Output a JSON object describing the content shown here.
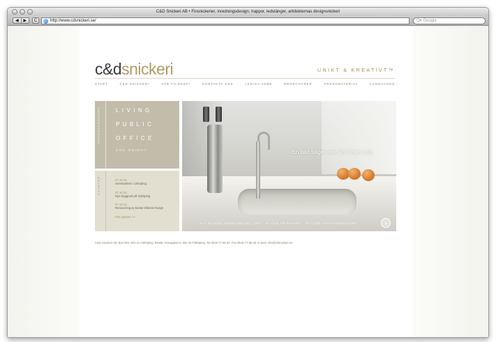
{
  "browser": {
    "window_title": "C&D Snickeri AB • Finsnickerier, inredningsdesign, trappor, ledstänger, arkitekternas designsnickeri",
    "nav_back": "◀",
    "nav_forward": "▶",
    "reload": "C",
    "url": "http://www.cdsnickeri.se/",
    "search_placeholder": "Q▾ Google"
  },
  "site": {
    "logo_prefix": "c&d",
    "logo_accent": "snickeri",
    "tagline": "UNIKT & KREATIVT™",
    "menu": [
      "START",
      "C&D SNICKERI",
      "VÅR FILOSOFI",
      "KONTAKTA OSS",
      "LEDIGA JOBB",
      "BROSCHYRER",
      "PRESSMATERIAL",
      "LANGUAGES"
    ],
    "sidebar_top_label": "UPPDRAGSGIVARE",
    "categories": [
      "LIVING",
      "PUBLIC",
      "OFFICE"
    ],
    "categories_sub": "SÖK OBJEKT",
    "sidebar_bottom_label": "NYHETER",
    "news": [
      {
        "date": "07.10.24",
        "title": "Sommarfest i Linköping"
      },
      {
        "date": "07.10.24",
        "title": "Nya byggnad på Nyköping"
      },
      {
        "date": "07.10.24",
        "title": "Renovering av kontor Elbesin Norge"
      }
    ],
    "news_more": "Fler nyheter >>",
    "hero_text": "En bild säger mer än tusen ord.",
    "hero_caption": "ALT BILDEN ÄNDRA OM DET HÄR · KLICKA PÅ BILDEN · SE FLER UPPDRAGSGIVARE",
    "hero_arrow": "›",
    "footer": "C&D Snickeri AB. Box 604, 591 21 Falköping. Besök: Sveagatan 9, 591 36 Falköping. Tel 0515-77 85 00. Fax 0515-77 85 08. E-post: info@cdsnickeri.se"
  }
}
